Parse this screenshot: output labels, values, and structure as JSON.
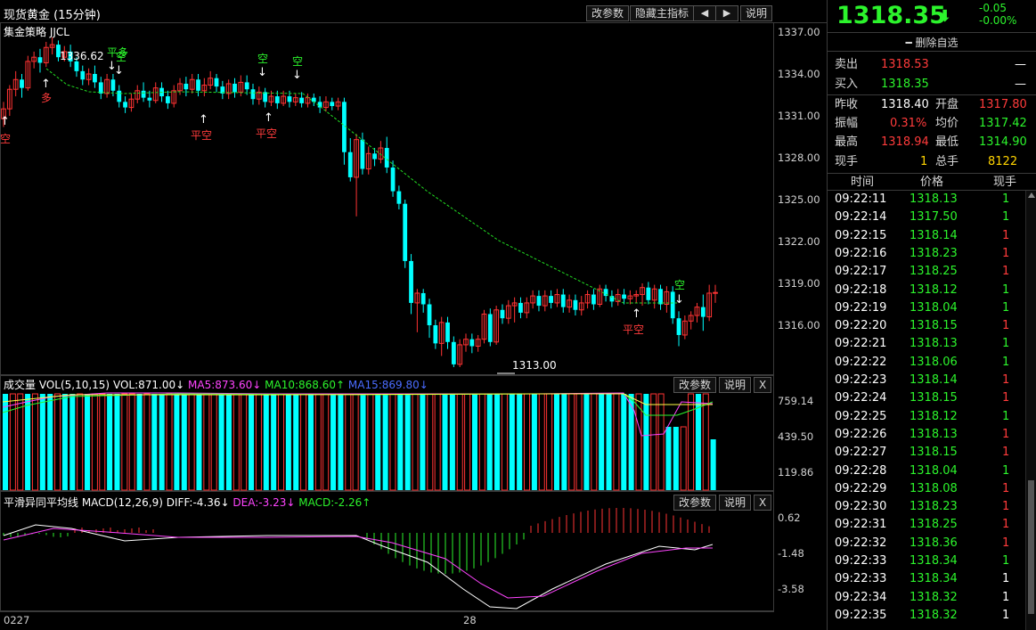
{
  "header": {
    "title": "现货黄金 (15分钟)",
    "buttons": {
      "params": "改参数",
      "hide_main": "隐藏主指标",
      "left": "◀",
      "right": "▶",
      "help": "说明"
    }
  },
  "strategy": {
    "label": "集金策略 JJCL"
  },
  "main_chart": {
    "price_axis": [
      "1337.00",
      "1334.00",
      "1331.00",
      "1328.00",
      "1325.00",
      "1322.00",
      "1319.00",
      "1316.00"
    ],
    "high_label": "1336.62",
    "low_label": "1313.00",
    "signals": {
      "kong1": "空",
      "duo": "多",
      "ping_duo": "平多",
      "kong2": "空",
      "ping_kong1": "平空",
      "kong3": "空",
      "ping_kong2": "平空",
      "kong4": "空",
      "ping_kong3": "平空",
      "kong5": "空"
    },
    "colors": {
      "up": "#ff3333",
      "down": "#00ffff",
      "trend": "#22dd22"
    }
  },
  "volume_panel": {
    "title": "成交量 VOL(5,10,15)",
    "vol": "VOL:871.00↓",
    "ma5": "MA5:873.60↓",
    "ma10": "MA10:868.60↑",
    "ma15": "MA15:869.80↓",
    "buttons": {
      "params": "改参数",
      "help": "说明",
      "close": "X"
    },
    "axis": [
      "759.14",
      "439.50",
      "119.86"
    ]
  },
  "macd_panel": {
    "title": "平滑异同平均线 MACD(12,26,9)",
    "diff": "DIFF:-4.36↓",
    "dea": "DEA:-3.23↓",
    "macd": "MACD:-2.26↑",
    "buttons": {
      "params": "改参数",
      "help": "说明",
      "close": "X"
    },
    "axis": [
      "0.62",
      "-1.48",
      "-3.58"
    ]
  },
  "time_axis": {
    "start": "0227",
    "mid": "28"
  },
  "quote": {
    "price": "1318.35",
    "change": "-0.05",
    "change_pct": "-0.00%",
    "delete_watch": "删除自选",
    "sell_label": "卖出",
    "sell_price": "1318.53",
    "sell_vol": "—",
    "buy_label": "买入",
    "buy_price": "1318.35",
    "buy_vol": "—",
    "prev_close_label": "昨收",
    "prev_close": "1318.40",
    "open_label": "开盘",
    "open": "1317.80",
    "amp_label": "振幅",
    "amp": "0.31%",
    "avg_label": "均价",
    "avg": "1317.42",
    "high_label": "最高",
    "high": "1318.94",
    "low_label": "最低",
    "low": "1314.90",
    "cur_vol_label": "现手",
    "cur_vol": "1",
    "total_vol_label": "总手",
    "total_vol": "8122"
  },
  "ticks": {
    "headers": [
      "时间",
      "价格",
      "现手"
    ],
    "rows": [
      {
        "time": "09:22:11",
        "price": "1318.13",
        "vol": "1",
        "dir": "down"
      },
      {
        "time": "09:22:14",
        "price": "1317.50",
        "vol": "1",
        "dir": "down"
      },
      {
        "time": "09:22:15",
        "price": "1318.14",
        "vol": "1",
        "dir": "up"
      },
      {
        "time": "09:22:16",
        "price": "1318.23",
        "vol": "1",
        "dir": "up"
      },
      {
        "time": "09:22:17",
        "price": "1318.25",
        "vol": "1",
        "dir": "up"
      },
      {
        "time": "09:22:18",
        "price": "1318.12",
        "vol": "1",
        "dir": "down"
      },
      {
        "time": "09:22:19",
        "price": "1318.04",
        "vol": "1",
        "dir": "down"
      },
      {
        "time": "09:22:20",
        "price": "1318.15",
        "vol": "1",
        "dir": "up"
      },
      {
        "time": "09:22:21",
        "price": "1318.13",
        "vol": "1",
        "dir": "down"
      },
      {
        "time": "09:22:22",
        "price": "1318.06",
        "vol": "1",
        "dir": "down"
      },
      {
        "time": "09:22:23",
        "price": "1318.14",
        "vol": "1",
        "dir": "up"
      },
      {
        "time": "09:22:24",
        "price": "1318.15",
        "vol": "1",
        "dir": "up"
      },
      {
        "time": "09:22:25",
        "price": "1318.12",
        "vol": "1",
        "dir": "down"
      },
      {
        "time": "09:22:26",
        "price": "1318.13",
        "vol": "1",
        "dir": "up"
      },
      {
        "time": "09:22:27",
        "price": "1318.15",
        "vol": "1",
        "dir": "up"
      },
      {
        "time": "09:22:28",
        "price": "1318.04",
        "vol": "1",
        "dir": "down"
      },
      {
        "time": "09:22:29",
        "price": "1318.08",
        "vol": "1",
        "dir": "up"
      },
      {
        "time": "09:22:30",
        "price": "1318.23",
        "vol": "1",
        "dir": "up"
      },
      {
        "time": "09:22:31",
        "price": "1318.25",
        "vol": "1",
        "dir": "up"
      },
      {
        "time": "09:22:32",
        "price": "1318.36",
        "vol": "1",
        "dir": "up"
      },
      {
        "time": "09:22:33",
        "price": "1318.34",
        "vol": "1",
        "dir": "down"
      },
      {
        "time": "09:22:33",
        "price": "1318.34",
        "vol": "1",
        "dir": "none"
      },
      {
        "time": "09:22:34",
        "price": "1318.32",
        "vol": "1",
        "dir": "none"
      },
      {
        "time": "09:22:35",
        "price": "1318.32",
        "vol": "1",
        "dir": "none"
      }
    ]
  }
}
